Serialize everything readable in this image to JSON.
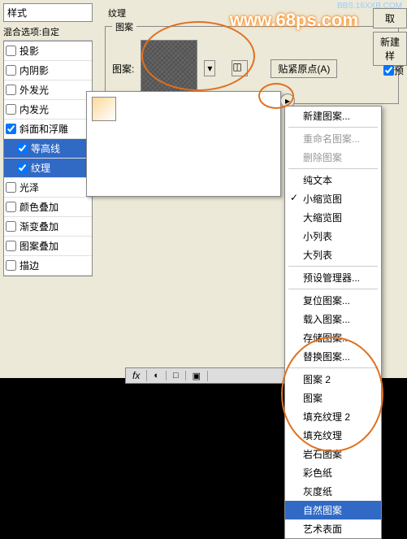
{
  "header": {
    "styles_label": "样式",
    "blend_label": "混合选项:自定"
  },
  "styles": {
    "items": [
      {
        "label": "投影",
        "checked": false,
        "selected": false
      },
      {
        "label": "内阴影",
        "checked": false,
        "selected": false
      },
      {
        "label": "外发光",
        "checked": false,
        "selected": false
      },
      {
        "label": "内发光",
        "checked": false,
        "selected": false
      },
      {
        "label": "斜面和浮雕",
        "checked": true,
        "selected": false
      },
      {
        "label": "等高线",
        "checked": true,
        "selected": true,
        "sub": true
      },
      {
        "label": "纹理",
        "checked": true,
        "selected": true,
        "sub": true
      },
      {
        "label": "光泽",
        "checked": false,
        "selected": false
      },
      {
        "label": "颜色叠加",
        "checked": false,
        "selected": false
      },
      {
        "label": "渐变叠加",
        "checked": false,
        "selected": false
      },
      {
        "label": "图案叠加",
        "checked": false,
        "selected": false
      },
      {
        "label": "描边",
        "checked": false,
        "selected": false
      }
    ]
  },
  "texture": {
    "group_label": "纹理",
    "pattern_group": "图案",
    "pattern_label": "图案:",
    "snap_origin": "贴紧原点(A)"
  },
  "right": {
    "cancel": "取",
    "new_style": "新建样",
    "preview": "预"
  },
  "menu": {
    "new_pattern": "新建图案...",
    "rename_pattern": "重命名图案...",
    "delete_pattern": "删除图案",
    "text_only": "纯文本",
    "small_thumb": "小缩览图",
    "large_thumb": "大缩览图",
    "small_list": "小列表",
    "large_list": "大列表",
    "preset_mgr": "预设管理器...",
    "reset": "复位图案...",
    "load": "载入图案...",
    "save": "存储图案...",
    "replace": "替换图案...",
    "presets": [
      "图案 2",
      "图案",
      "填充纹理 2",
      "填充纹理",
      "岩石图案",
      "彩色纸",
      "灰度纸",
      "自然图案",
      "艺术表面"
    ],
    "selected_preset": "自然图案"
  },
  "watermark": {
    "url": "www.68ps.com",
    "small": "BBS.16XXB.COM"
  },
  "status": {
    "fx": "fx"
  }
}
